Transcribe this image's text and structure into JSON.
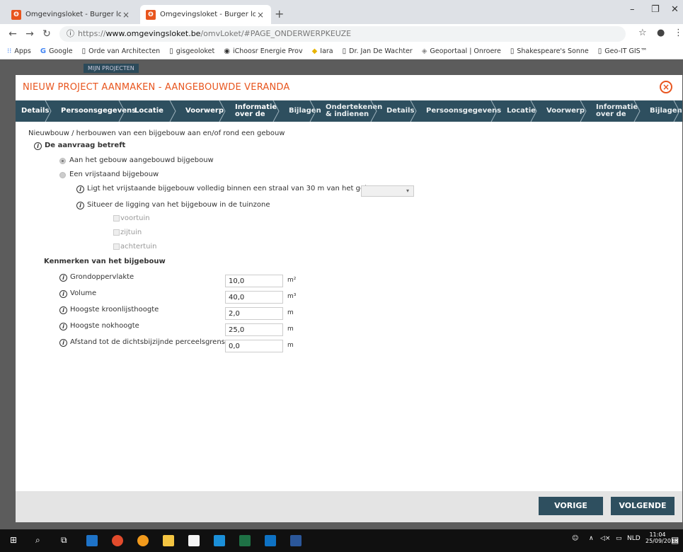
{
  "browser": {
    "tabs": [
      {
        "title": "Omgevingsloket - Burger loket",
        "active": false
      },
      {
        "title": "Omgevingsloket - Burger loket",
        "active": true
      }
    ],
    "new_tab": "+",
    "url_scheme": "https://",
    "url_host": "www.omgevingsloket.be",
    "url_path": "/omvLoket/#PAGE_ONDERWERPKEUZE",
    "bookmarks": [
      "Apps",
      "Google",
      "Orde van Architecten",
      "gisgeoloket",
      "iChoosr Energie Prov",
      "Iara",
      "Dr. Jan De Wachter",
      "Geoportaal | Onroere",
      "Shakespeare's Sonne",
      "Geo-IT GIS™"
    ]
  },
  "page": {
    "projects_label": "MIJN PROJECTEN"
  },
  "modal": {
    "title": "NIEUW PROJECT AANMAKEN - AANGEBOUWDE VERANDA",
    "steps": [
      {
        "label": "Details",
        "active": true
      },
      {
        "label": "Persoonsgegevens",
        "active": true
      },
      {
        "label": "Locatie",
        "active": true
      },
      {
        "label": "Voorwerp",
        "active": true
      },
      {
        "label": "Informatie\nover de",
        "active": true
      },
      {
        "label": "Bijlagen",
        "active": false
      },
      {
        "label": "Ondertekenen\n& indienen",
        "active": false
      },
      {
        "label": "Details",
        "active": false
      },
      {
        "label": "Persoonsgegevens",
        "active": false
      },
      {
        "label": "Locatie",
        "active": false
      },
      {
        "label": "Voorwerp",
        "active": false
      },
      {
        "label": "Informatie\nover de",
        "active": false
      },
      {
        "label": "Bijlagen",
        "active": false
      }
    ],
    "intro": "Nieuwbouw / herbouwen van een bijgebouw aan en/of rond een gebouw",
    "aanvraag_label": "De aanvraag betreft",
    "radio_1": "Aan het gebouw aangebouwd bijgebouw",
    "radio_2": "Een vrijstaand bijgebouw",
    "question_30m": "Ligt het vrijstaande bijgebouw volledig binnen een straal van 30 m van het gebouw?",
    "situeer": "Situeer de ligging van het bijgebouw in de tuinzone",
    "checkboxes": [
      "voortuin",
      "zijtuin",
      "achtertuin"
    ],
    "kenmerken_title": "Kenmerken van het bijgebouw",
    "fields": [
      {
        "label": "Grondoppervlakte",
        "value": "10,0",
        "unit": "m²"
      },
      {
        "label": "Volume",
        "value": "40,0",
        "unit": "m³"
      },
      {
        "label": "Hoogste kroonlijsthoogte",
        "value": "2,0",
        "unit": "m"
      },
      {
        "label": "Hoogste nokhoogte",
        "value": "25,0",
        "unit": "m"
      },
      {
        "label": "Afstand tot de dichtsbijzijnde perceelsgrens",
        "value": "0,0",
        "unit": "m"
      }
    ],
    "btn_prev": "VORIGE",
    "btn_next": "VOLGENDE"
  },
  "taskbar": {
    "lang": "NLD",
    "time": "11:04",
    "date": "25/09/2018"
  },
  "colors": {
    "accent": "#e8551e",
    "nav": "#2e4f5f"
  }
}
